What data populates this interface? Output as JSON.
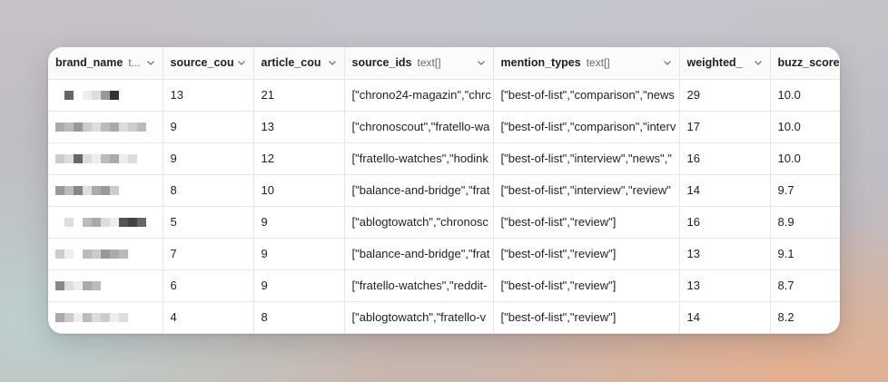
{
  "table": {
    "columns": [
      {
        "name": "brand_name",
        "type": "t..."
      },
      {
        "name": "source_cou",
        "type": ""
      },
      {
        "name": "article_cou",
        "type": ""
      },
      {
        "name": "source_ids",
        "type": "text[]"
      },
      {
        "name": "mention_types",
        "type": "text[]"
      },
      {
        "name": "weighted_",
        "type": ""
      },
      {
        "name": "buzz_score",
        "type": ""
      }
    ],
    "rows": [
      {
        "brand_name": "",
        "source_count": "13",
        "article_count": "21",
        "source_ids": "[\"chrono24-magazin\",\"chrc",
        "mention_types": "[\"best-of-list\",\"comparison\",\"news",
        "weighted": "29",
        "buzz_score": "10.0"
      },
      {
        "brand_name": "",
        "source_count": "9",
        "article_count": "13",
        "source_ids": "[\"chronoscout\",\"fratello-wa",
        "mention_types": "[\"best-of-list\",\"comparison\",\"interv",
        "weighted": "17",
        "buzz_score": "10.0"
      },
      {
        "brand_name": "",
        "source_count": "9",
        "article_count": "12",
        "source_ids": "[\"fratello-watches\",\"hodink",
        "mention_types": "[\"best-of-list\",\"interview\",\"news\",\"",
        "weighted": "16",
        "buzz_score": "10.0"
      },
      {
        "brand_name": "",
        "source_count": "8",
        "article_count": "10",
        "source_ids": "[\"balance-and-bridge\",\"frat",
        "mention_types": "[\"best-of-list\",\"interview\",\"review\"",
        "weighted": "14",
        "buzz_score": "9.7"
      },
      {
        "brand_name": "",
        "source_count": "5",
        "article_count": "9",
        "source_ids": "[\"ablogtowatch\",\"chronosc",
        "mention_types": "[\"best-of-list\",\"review\"]",
        "weighted": "16",
        "buzz_score": "8.9"
      },
      {
        "brand_name": "",
        "source_count": "7",
        "article_count": "9",
        "source_ids": "[\"balance-and-bridge\",\"frat",
        "mention_types": "[\"best-of-list\",\"review\"]",
        "weighted": "13",
        "buzz_score": "9.1"
      },
      {
        "brand_name": "",
        "source_count": "6",
        "article_count": "9",
        "source_ids": "[\"fratello-watches\",\"reddit-",
        "mention_types": "[\"best-of-list\",\"review\"]",
        "weighted": "13",
        "buzz_score": "8.7"
      },
      {
        "brand_name": "",
        "source_count": "4",
        "article_count": "8",
        "source_ids": "[\"ablogtowatch\",\"fratello-v",
        "mention_types": "[\"best-of-list\",\"review\"]",
        "weighted": "14",
        "buzz_score": "8.2"
      }
    ]
  },
  "icons": {
    "sort_chevron": "chevron-down-icon"
  },
  "colors": {
    "border": "#e6e6e6",
    "header_bg": "#fbfbfb",
    "window_bg": "#ffffff"
  }
}
